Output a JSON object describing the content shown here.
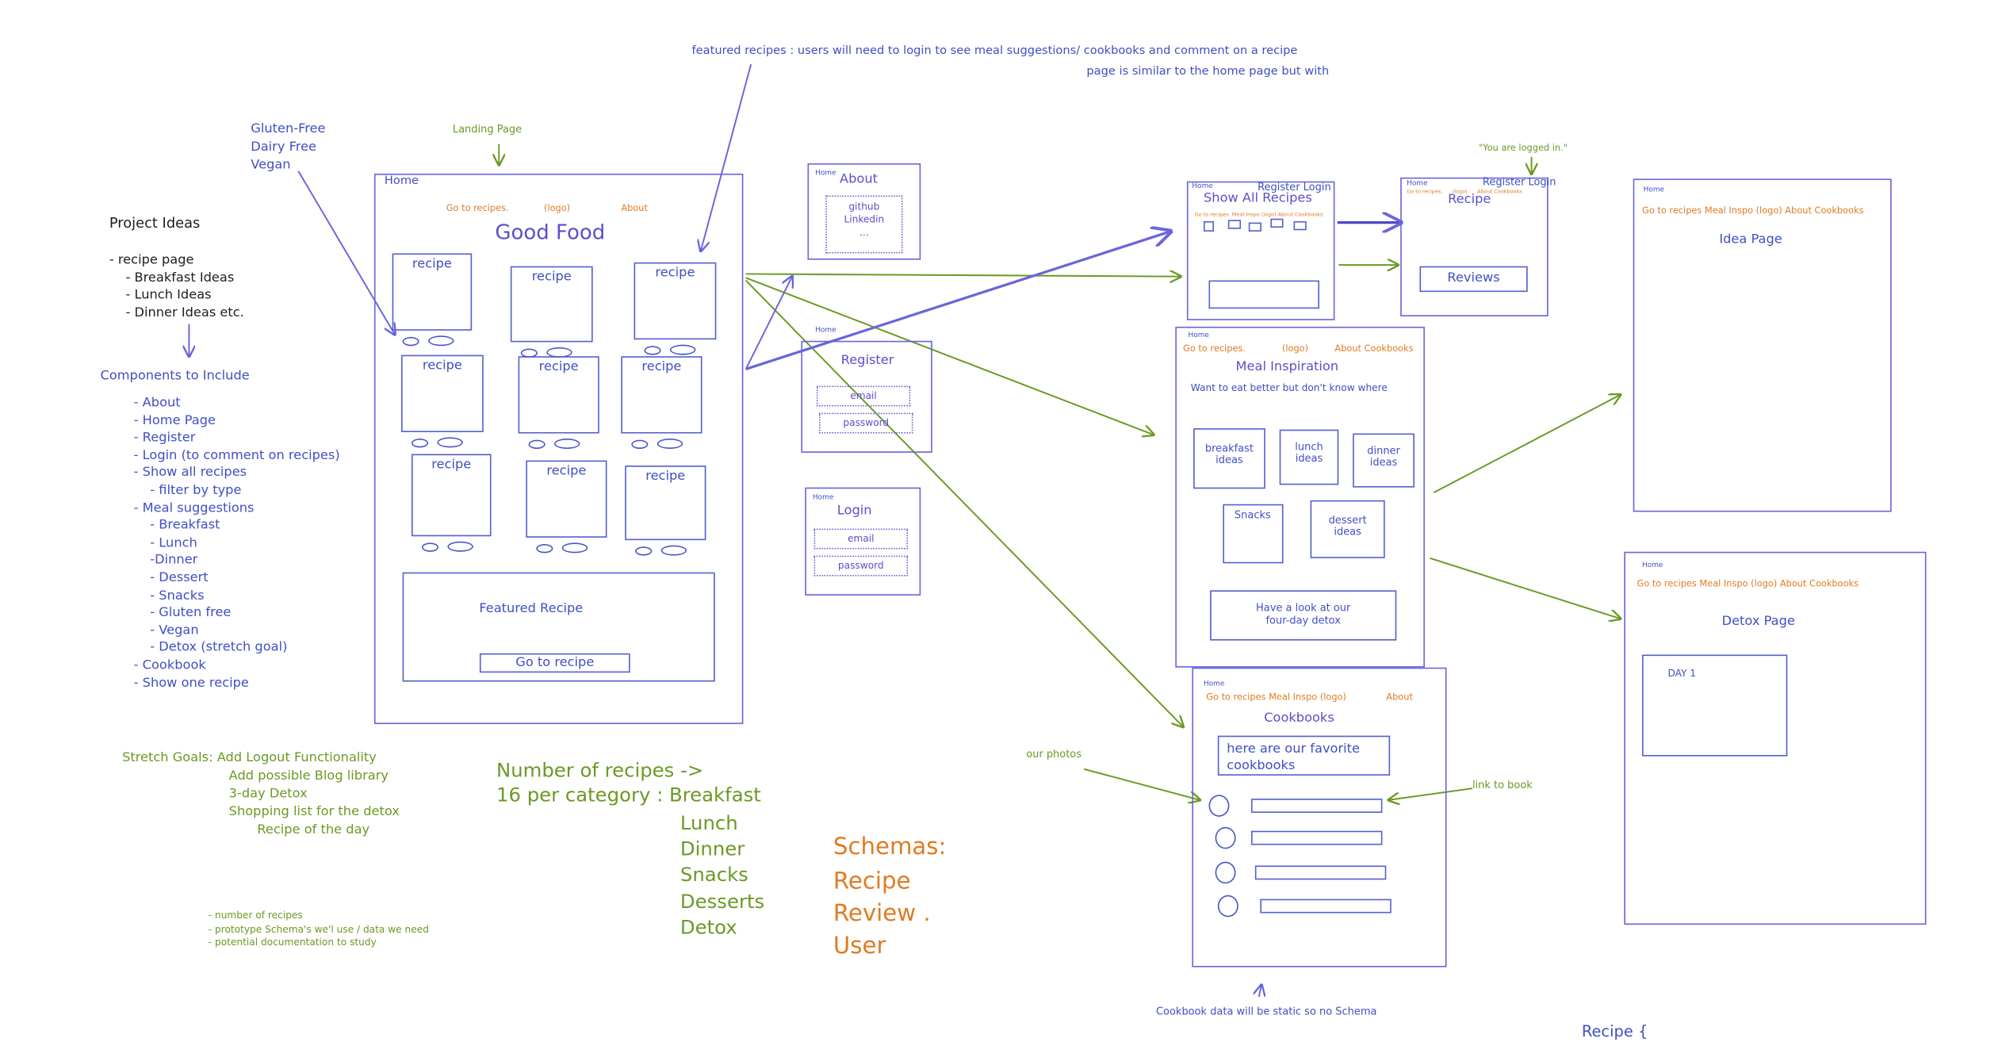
{
  "colors": {
    "frame": "#6965db",
    "text_blue": "#3f4fc4",
    "orange": "#e07b22",
    "green": "#6a9a23"
  },
  "notes": {
    "featured_note": "featured recipes : users will need to login to see meal suggestions/ cookbooks and comment on a recipe",
    "similar_note": "page is similar to the home page but with",
    "diet_tags": [
      "Gluten-Free",
      "Dairy Free",
      "Vegan"
    ],
    "landing_page": "Landing Page",
    "logged_in": "\"You are logged in.\"",
    "our_photos": "our photos",
    "link_to_book": "link to book",
    "cookbook_static": "Cookbook data will be static so no Schema",
    "recipe_schema": "Recipe {"
  },
  "project_ideas": {
    "title": "Project Ideas",
    "items": [
      "- recipe page",
      "    - Breakfast Ideas",
      "    - Lunch Ideas",
      "    - Dinner Ideas etc."
    ]
  },
  "components": {
    "title": "Components to Include",
    "items": [
      "- About",
      "- Home Page",
      "- Register",
      "- Login (to comment on recipes)",
      "- Show all recipes",
      "    - filter by type",
      "- Meal suggestions",
      "    - Breakfast",
      "    - Lunch",
      "    -Dinner",
      "    - Dessert",
      "    - Snacks",
      "    - Gluten free",
      "    - Vegan",
      "    - Detox (stretch goal)",
      "- Cookbook",
      "- Show one recipe"
    ]
  },
  "stretch_goals": [
    "Stretch Goals: Add Logout Functionality",
    "Add possible Blog library",
    "3-day Detox",
    "Shopping list for the detox",
    "Recipe of the day"
  ],
  "todo": [
    "- number of recipes",
    "- prototype Schema's we'l use / data we need",
    "- potential documentation to study"
  ],
  "recipe_counts": {
    "line1": "Number of recipes ->",
    "line2": "16 per category : Breakfast",
    "categories": [
      "Lunch",
      "Dinner",
      "Snacks",
      "Desserts",
      "Detox"
    ]
  },
  "schemas": {
    "title": "Schemas:",
    "items": [
      "Recipe",
      "Review .",
      "User"
    ]
  },
  "home": {
    "home_link": "Home",
    "nav": [
      "Go to recipes.",
      "(logo)",
      "About"
    ],
    "title": "Good Food",
    "recipe_label": "recipe",
    "featured_title": "Featured Recipe",
    "featured_button": "Go to recipe"
  },
  "about": {
    "home_link": "Home",
    "title": "About",
    "links": [
      "github",
      "Linkedin",
      "..."
    ]
  },
  "register": {
    "home_link": "Home",
    "title": "Register",
    "email": "email",
    "password": "password"
  },
  "login": {
    "home_link": "Home",
    "title": "Login",
    "email": "email",
    "password": "password"
  },
  "show_all": {
    "home_link": "Home",
    "auth": "Register Login",
    "title": "Show All Recipes",
    "nav": "Go to recipes.  Meal Inspo  (logo)  About Cookbooks"
  },
  "recipe_page": {
    "home_link": "Home",
    "auth": "Register Login",
    "nav": "Go to recipes.      (logo)      About Cookbooks",
    "title": "Recipe",
    "reviews": "Reviews"
  },
  "meal_inspiration": {
    "home_link": "Home",
    "nav": [
      "Go to recipes.",
      "(logo)",
      "About Cookbooks"
    ],
    "title": "Meal Inspiration",
    "subtitle": "Want to eat better but don't know where",
    "tiles": [
      "breakfast ideas",
      "lunch ideas",
      "dinner ideas",
      "Snacks",
      "dessert ideas"
    ],
    "detox_button": "Have a look at our four-day detox"
  },
  "cookbooks": {
    "home_link": "Home",
    "nav": "Go to recipes Meal Inspo  (logo)",
    "about": "About",
    "title": "Cookbooks",
    "intro": "here are our favorite cookbooks"
  },
  "idea_page": {
    "home_link": "Home",
    "nav": "Go to recipes  Meal Inspo  (logo)  About Cookbooks",
    "title": "Idea Page"
  },
  "detox_page": {
    "home_link": "Home",
    "nav": "Go to recipes  Meal Inspo  (logo)  About Cookbooks",
    "title": "Detox Page",
    "day": "DAY 1"
  }
}
